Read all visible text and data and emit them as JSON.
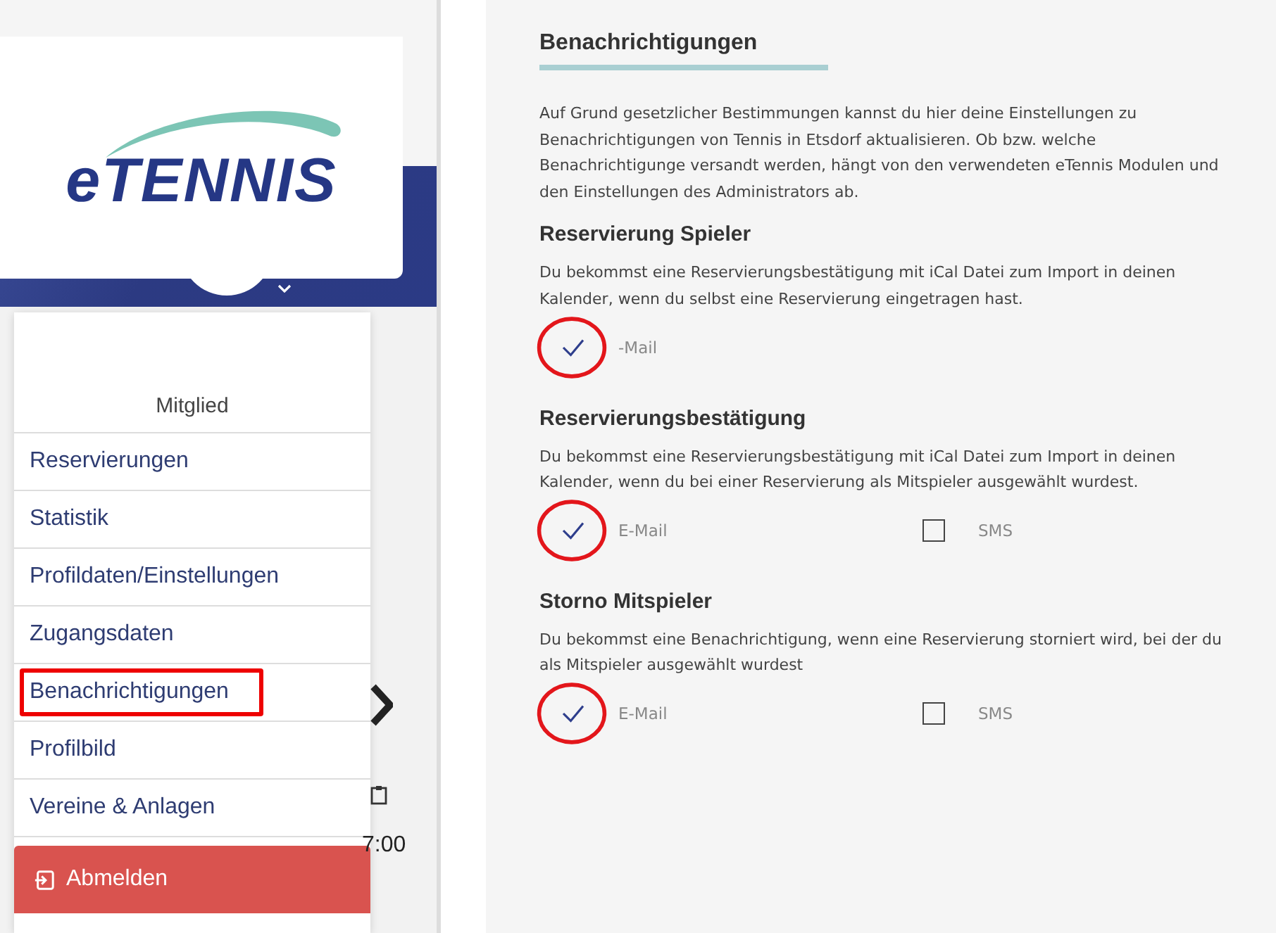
{
  "logo": {
    "text": "eTENNIS"
  },
  "menu": {
    "heading": "Mitglied",
    "items": [
      {
        "label": "Reservierungen",
        "highlighted": false
      },
      {
        "label": "Statistik",
        "highlighted": false
      },
      {
        "label": "Profildaten/Einstellungen",
        "highlighted": false
      },
      {
        "label": "Zugangsdaten",
        "highlighted": false
      },
      {
        "label": "Benachrichtigungen",
        "highlighted": true
      },
      {
        "label": "Profilbild",
        "highlighted": false
      },
      {
        "label": "Vereine & Anlagen",
        "highlighted": false
      }
    ],
    "logout": "Abmelden"
  },
  "background_time": "7:00",
  "page": {
    "title": "Benachrichtigungen",
    "intro": "Auf Grund gesetzlicher Bestimmungen kannst du hier deine Einstellungen zu Benachrichtigungen von Tennis in Etsdorf aktualisieren. Ob bzw. welche Benachrichtigunge versandt werden, hängt von den verwendeten eTennis Modulen und den Einstellungen des Administrators ab.",
    "sections": [
      {
        "title": "Reservierung Spieler",
        "text": "Du bekommst eine Reservierungsbestätigung mit iCal Datei zum Import in deinen Kalender, wenn du selbst eine Reservierung eingetragen hast.",
        "options": [
          {
            "label": "-Mail",
            "checked": true,
            "highlighted": true
          }
        ]
      },
      {
        "title": "Reservierungsbestätigung",
        "text": "Du bekommst eine Reservierungsbestätigung mit iCal Datei zum Import in deinen Kalender, wenn du bei einer Reservierung als Mitspieler ausgewählt wurdest.",
        "options": [
          {
            "label": "E-Mail",
            "checked": true,
            "highlighted": true
          },
          {
            "label": "SMS",
            "checked": false,
            "highlighted": false
          }
        ]
      },
      {
        "title": "Storno Mitspieler",
        "text": "Du bekommst eine Benachrichtigung, wenn eine Reservierung storniert wird, bei der du als Mitspieler ausgewählt wurdest",
        "options": [
          {
            "label": "E-Mail",
            "checked": true,
            "highlighted": true
          },
          {
            "label": "SMS",
            "checked": false,
            "highlighted": false
          }
        ]
      }
    ]
  }
}
